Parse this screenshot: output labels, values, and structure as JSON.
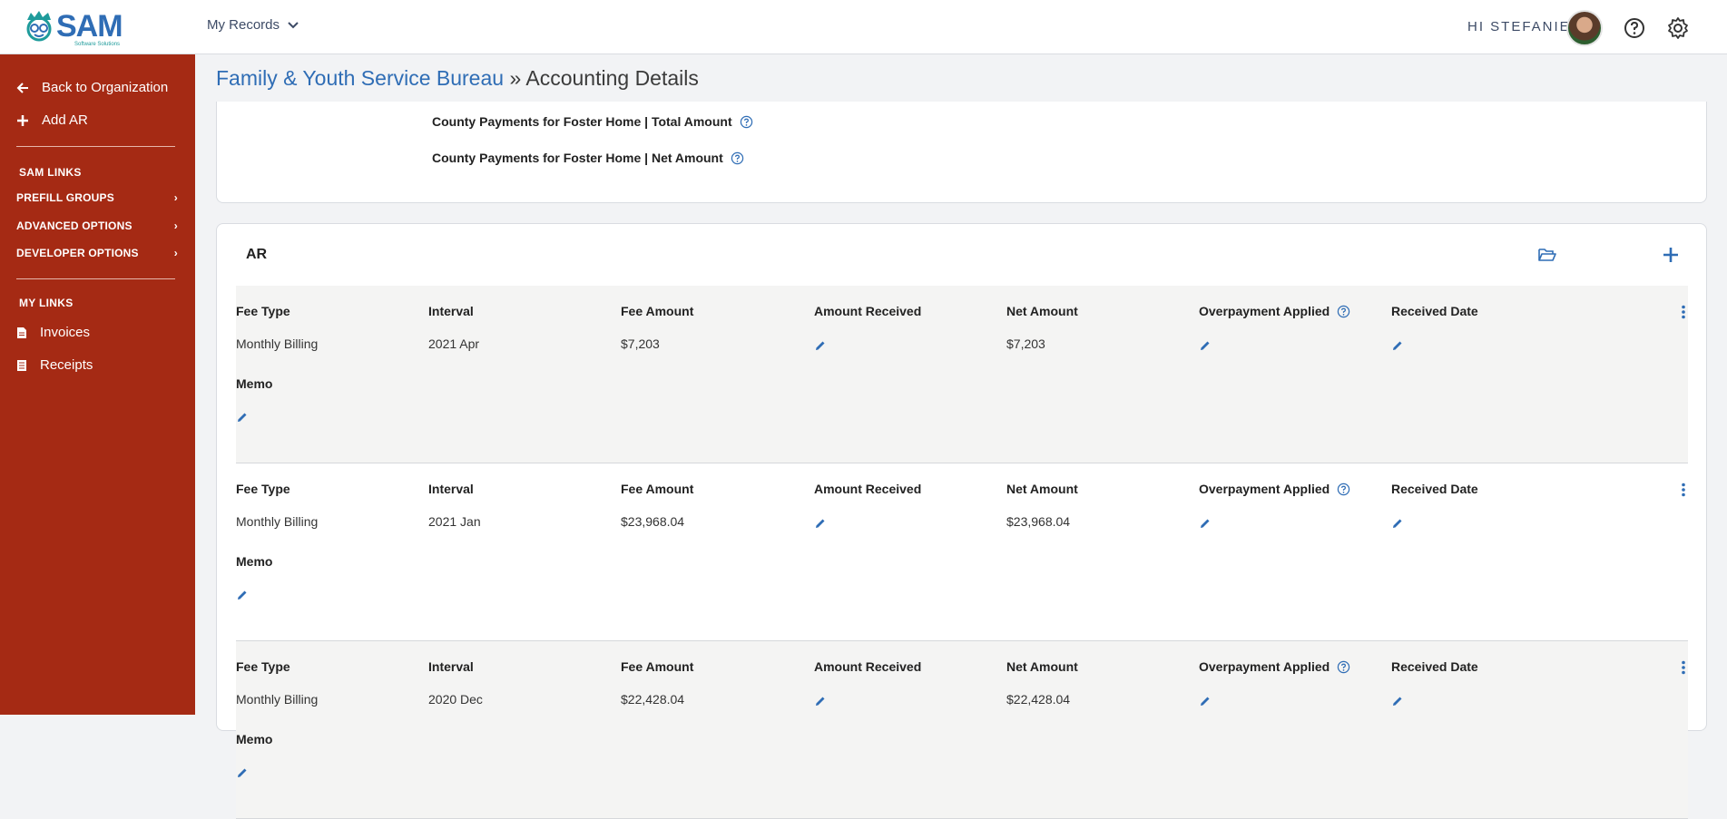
{
  "header": {
    "logo_text": "SAM",
    "logo_sub": "Software Solutions",
    "records_label": "My Records",
    "greeting": "HI STEFANIE"
  },
  "sidebar": {
    "back_label": "Back to Organization",
    "add_label": "Add AR",
    "sam_links": "SAM LINKS",
    "prefill": "PREFILL GROUPS",
    "advanced": "ADVANCED OPTIONS",
    "developer": "DEVELOPER OPTIONS",
    "my_links": "MY LINKS",
    "invoices": "Invoices",
    "receipts": "Receipts"
  },
  "page": {
    "org_name": "Family & Youth Service Bureau",
    "separator": " » ",
    "section": "Accounting Details"
  },
  "county": {
    "total_label": "County Payments for Foster Home | Total Amount",
    "net_label": "County Payments for Foster Home | Net Amount"
  },
  "ar": {
    "title": "AR",
    "columns": {
      "fee_type": "Fee Type",
      "interval": "Interval",
      "fee_amount": "Fee Amount",
      "amount_received": "Amount Received",
      "net_amount": "Net Amount",
      "overpayment": "Overpayment Applied",
      "received_date": "Received Date",
      "memo": "Memo"
    },
    "rows": [
      {
        "fee_type": "Monthly Billing",
        "interval": "2021 Apr",
        "fee_amount": "$7,203",
        "net_amount": "$7,203"
      },
      {
        "fee_type": "Monthly Billing",
        "interval": "2021 Jan",
        "fee_amount": "$23,968.04",
        "net_amount": "$23,968.04"
      },
      {
        "fee_type": "Monthly Billing",
        "interval": "2020 Dec",
        "fee_amount": "$22,428.04",
        "net_amount": "$22,428.04"
      }
    ]
  },
  "colors": {
    "sidebar": "#a52a14",
    "accent": "#2f6db5"
  }
}
